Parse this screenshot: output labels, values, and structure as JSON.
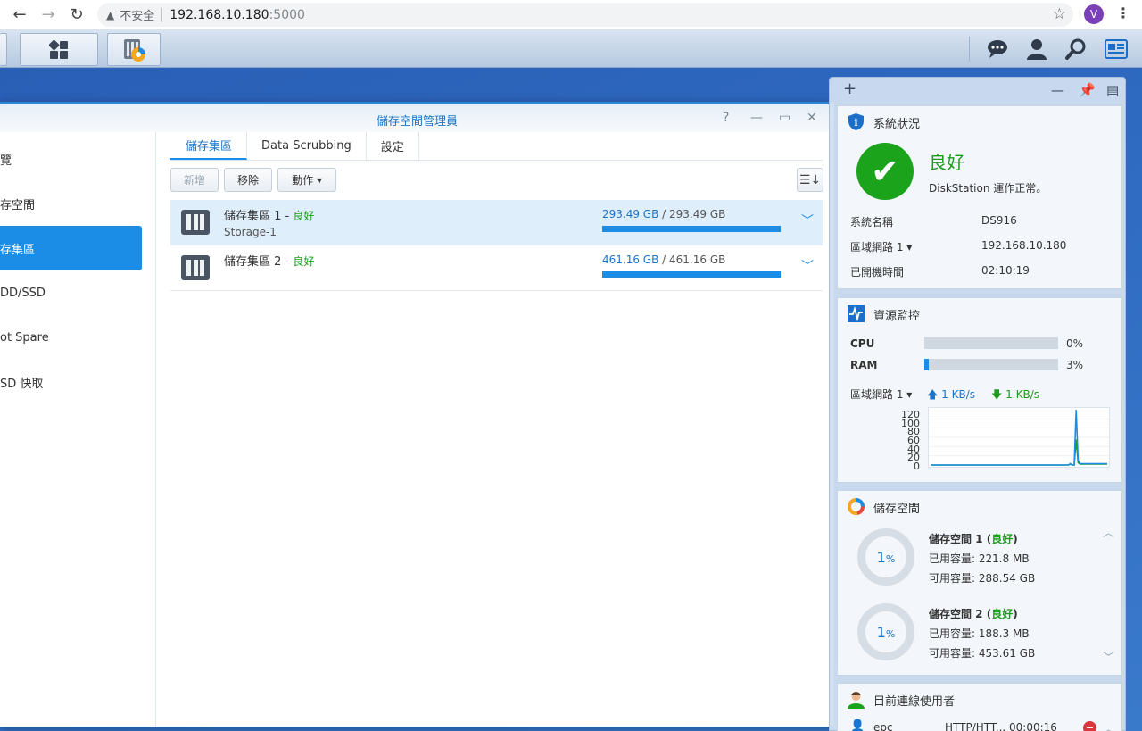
{
  "browser": {
    "insecure_label": "不安全",
    "url_host": "192.168.10.180",
    "url_port": ":5000",
    "profile_initial": "V"
  },
  "window": {
    "title": "儲存空間管理員"
  },
  "sidebar": {
    "items": [
      {
        "label": "覽"
      },
      {
        "label": "存空間"
      },
      {
        "label": "存集區"
      },
      {
        "label": "DD/SSD"
      },
      {
        "label": "ot Spare"
      },
      {
        "label": "SD 快取"
      }
    ]
  },
  "tabs": [
    {
      "label": "儲存集區"
    },
    {
      "label": "Data Scrubbing"
    },
    {
      "label": "設定"
    }
  ],
  "toolbar": {
    "create_label": "新增",
    "remove_label": "移除",
    "action_label": "動作 ▾"
  },
  "pools": [
    {
      "name": "儲存集區 1",
      "dash": " - ",
      "status": "良好",
      "sub": "Storage-1",
      "used": "293.49 GB",
      "total": " / 293.49 GB",
      "fill_percent": 100
    },
    {
      "name": "儲存集區 2",
      "dash": " - ",
      "status": "良好",
      "sub": "",
      "used": "461.16 GB",
      "total": " / 461.16 GB",
      "fill_percent": 100
    }
  ],
  "system_status": {
    "title": "系統狀況",
    "health": "良好",
    "desc": "DiskStation 運作正常。",
    "rows": [
      {
        "label": "系統名稱",
        "value": "DS916"
      },
      {
        "label": "區域網路 1 ▾",
        "value": "192.168.10.180"
      },
      {
        "label": "已開機時間",
        "value": "02:10:19"
      }
    ]
  },
  "resource_monitor": {
    "title": "資源監控",
    "cpu_label": "CPU",
    "cpu_value": "0%",
    "cpu_percent": 0,
    "ram_label": "RAM",
    "ram_value": "3%",
    "ram_percent": 3,
    "net_label": "區域網路 1 ▾",
    "net_up": "1 KB/s",
    "net_down": "1 KB/s",
    "y_ticks": [
      "120",
      "100",
      "80",
      "60",
      "40",
      "20",
      "0"
    ]
  },
  "chart_data": {
    "type": "line",
    "ylim": [
      0,
      120
    ],
    "series": [
      {
        "color": "#1c8de6",
        "values": [
          0,
          0,
          0,
          0,
          0,
          0,
          0,
          0,
          0,
          0,
          0,
          0,
          0,
          0,
          0,
          0,
          0,
          0,
          0,
          0,
          0,
          0,
          0,
          0,
          0,
          0,
          0,
          0,
          0,
          0,
          0,
          0,
          0,
          0,
          0,
          0,
          0,
          0,
          0,
          0,
          0,
          0,
          0,
          0,
          0,
          0,
          0,
          0,
          0,
          0,
          0,
          0,
          0,
          0,
          0,
          0,
          0,
          0,
          0,
          0,
          0,
          0,
          0,
          0,
          0,
          0,
          0,
          0,
          0,
          0,
          0,
          0,
          3,
          0,
          0,
          125,
          10,
          3,
          3,
          3,
          3,
          3,
          3,
          3,
          3,
          3,
          3,
          3,
          3,
          3,
          3,
          3
        ]
      },
      {
        "color": "#1d9b1d",
        "values": [
          0,
          0,
          0,
          0,
          0,
          0,
          0,
          0,
          0,
          0,
          0,
          0,
          0,
          0,
          0,
          0,
          0,
          0,
          0,
          0,
          0,
          0,
          0,
          0,
          0,
          0,
          0,
          0,
          0,
          0,
          0,
          0,
          0,
          0,
          0,
          0,
          0,
          0,
          0,
          0,
          0,
          0,
          0,
          0,
          0,
          0,
          0,
          0,
          0,
          0,
          0,
          0,
          0,
          0,
          0,
          0,
          0,
          0,
          0,
          0,
          0,
          0,
          0,
          0,
          0,
          0,
          0,
          0,
          0,
          0,
          0,
          0,
          2,
          0,
          0,
          55,
          5,
          2,
          2,
          2,
          2,
          2,
          2,
          2,
          2,
          2,
          2,
          2,
          2,
          2,
          2,
          2
        ]
      }
    ]
  },
  "storage_widget": {
    "title": "儲存空間",
    "volumes": [
      {
        "pct": "1",
        "pct_unit": "%",
        "name": "儲存空間 1 (",
        "status": "良好",
        "close": ")",
        "used": "已用容量: 221.8 MB",
        "free": "可用容量: 288.54 GB"
      },
      {
        "pct": "1",
        "pct_unit": "%",
        "name": "儲存空間 2 (",
        "status": "良好",
        "close": ")",
        "used": "已用容量: 188.3 MB",
        "free": "可用容量: 453.61 GB"
      }
    ]
  },
  "users_widget": {
    "title": "目前連線使用者",
    "user": "epc",
    "protocol": "HTTP/HTT...",
    "time": "00:00:16"
  }
}
